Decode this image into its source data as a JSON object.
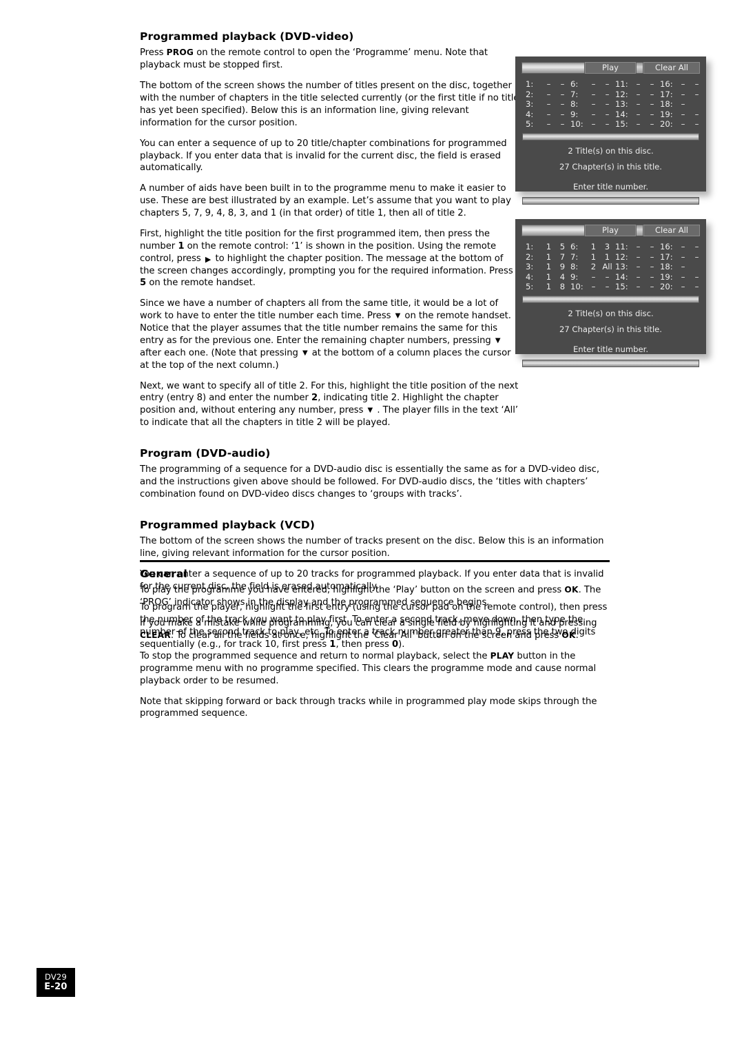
{
  "sections": {
    "dvd_video": {
      "heading": "Programmed playback (DVD-video)",
      "p1_a": "Press ",
      "p1_b": "PROG",
      "p1_c": " on the remote control to open the ‘Programme’ menu. Note that playback must be stopped first.",
      "p2": "The bottom of the screen shows the number of titles present on the disc, together with the number of chapters in the title selected currently (or the first title if no title has yet been specified). Below this is an information line, giving relevant information for the cursor position.",
      "p3": "You can enter a sequence of up to 20 title/chapter combinations for programmed playback. If you enter data that is invalid for the current disc, the field is erased automatically.",
      "p4": "A number of aids have been built in to the programme menu to make it easier to use. These are best illustrated by an example. Let’s assume that you want to play chapters 5, 7, 9, 4, 8, 3, and 1 (in that order) of title 1, then all of title 2.",
      "p5_a": "First, highlight the title position for the first programmed item, then press the number ",
      "p5_b": "1",
      "p5_c": " on the remote control: ‘1’ is shown in the position. Using the remote control, press ",
      "p5_arrow": "▶",
      "p5_d": " to highlight the chapter position. The message at the bottom of the screen changes accordingly, prompting you for the required information. Press ",
      "p5_e": "5",
      "p5_f": " on the remote handset.",
      "p6_a": "Since we have a number of chapters all from the same title, it would be a lot of work to have to enter the title number each time. Press ",
      "p6_arrow1": "▼",
      "p6_b": " on the remote handset. Notice that the player assumes that the title number remains the same for this entry as for the previous one. Enter the remaining chapter numbers, pressing ",
      "p6_arrow2": "▼",
      "p6_c": " after each one. (Note that pressing ",
      "p6_arrow3": "▼",
      "p6_d": " at the bottom of a column places the cursor at the top of the next column.)",
      "p7_a": "Next, we want to specify all of title 2. For this, highlight the title position of the next entry (entry 8) and enter the number ",
      "p7_b": "2",
      "p7_c": ", indicating title 2. Highlight the chapter position and, without entering any number, press ",
      "p7_arrow": "▼",
      "p7_d": " . The player fills in the text ‘All’ to indicate that all the chapters in title 2 will be played."
    },
    "dvd_audio": {
      "heading": "Program (DVD-audio)",
      "p1": "The programming of a sequence for a DVD-audio disc is essentially the same as for a DVD-video disc, and the instructions given above should be followed. For DVD-audio discs, the ‘titles with chapters’ combination found on DVD-video discs changes to ‘groups with tracks’."
    },
    "vcd": {
      "heading": "Programmed playback (VCD)",
      "p1": "The bottom of the screen shows the number of tracks present on the disc. Below this is an information line, giving relevant information for the cursor position.",
      "p2": "You can enter a sequence of up to 20 tracks for programmed playback. If you enter data that is invalid for the current disc, the field is erased automatically.",
      "p3_a": "To program the player, highlight the first entry (using the cursor pad on the remote control), then press the number of the track you want to play first. To enter a second track, move down, then type the number of the second track to play, etc. To enter a track number greater than 9, press the two digits sequentially (e.g., for track 10, first press ",
      "p3_b": "1",
      "p3_c": ", then press ",
      "p3_d": "0",
      "p3_e": ")."
    },
    "general": {
      "heading": "General",
      "p1_a": "To play the programme you have entered, highlight the ‘Play’ button on the screen and press ",
      "p1_b": "OK",
      "p1_c": ". The ‘PROG’ indicator shows in the display and the programmed sequence begins.",
      "p2_a": "If you make a mistake while programming, you can clear a single field by highlighting it and pressing ",
      "p2_b": "CLEAR",
      "p2_c": ". To clear all the fields at once, highlight the ‘Clear All’ button on the screen and press ",
      "p2_d": "OK",
      "p2_e": ".",
      "p3_a": "To stop the programmed sequence and return to normal playback, select the ",
      "p3_b": "PLAY",
      "p3_c": " button in the programme menu with no programme specified. This clears the programme mode and cause normal playback order to be resumed.",
      "p4": "Note that skipping forward or back through tracks while in programmed play mode skips through the programmed sequence."
    }
  },
  "osd_empty": {
    "play_label": "Play",
    "clear_all_label": "Clear All",
    "entries": [
      {
        "index": "1:",
        "v1": "–",
        "v2": "–"
      },
      {
        "index": "2:",
        "v1": "–",
        "v2": "–"
      },
      {
        "index": "3:",
        "v1": "–",
        "v2": "–"
      },
      {
        "index": "4:",
        "v1": "–",
        "v2": "–"
      },
      {
        "index": "5:",
        "v1": "–",
        "v2": "–"
      },
      {
        "index": "6:",
        "v1": "–",
        "v2": "–"
      },
      {
        "index": "7:",
        "v1": "–",
        "v2": "–"
      },
      {
        "index": "8:",
        "v1": "–",
        "v2": "–"
      },
      {
        "index": "9:",
        "v1": "–",
        "v2": "–"
      },
      {
        "index": "10:",
        "v1": "–",
        "v2": "–"
      },
      {
        "index": "11:",
        "v1": "–",
        "v2": "–"
      },
      {
        "index": "12:",
        "v1": "–",
        "v2": "–"
      },
      {
        "index": "13:",
        "v1": "–",
        "v2": "–"
      },
      {
        "index": "14:",
        "v1": "–",
        "v2": "–"
      },
      {
        "index": "15:",
        "v1": "–",
        "v2": "–"
      },
      {
        "index": "16:",
        "v1": "–",
        "v2": "–"
      },
      {
        "index": "17:",
        "v1": "–",
        "v2": "–"
      },
      {
        "index": "18:",
        "v1": "–",
        "v2": ""
      },
      {
        "index": "19:",
        "v1": "–",
        "v2": "–"
      },
      {
        "index": "20:",
        "v1": "–",
        "v2": "–"
      }
    ],
    "info_line_1": "2  Title(s) on this disc.",
    "info_line_2": "27 Chapter(s) in this title.",
    "prompt": "Enter title number."
  },
  "osd_programmed": {
    "play_label": "Play",
    "clear_all_label": "Clear All",
    "entries": [
      {
        "index": "1:",
        "v1": "1",
        "v2": "5"
      },
      {
        "index": "2:",
        "v1": "1",
        "v2": "7"
      },
      {
        "index": "3:",
        "v1": "1",
        "v2": "9"
      },
      {
        "index": "4:",
        "v1": "1",
        "v2": "4"
      },
      {
        "index": "5:",
        "v1": "1",
        "v2": "8"
      },
      {
        "index": "6:",
        "v1": "1",
        "v2": "3"
      },
      {
        "index": "7:",
        "v1": "1",
        "v2": "1"
      },
      {
        "index": "8:",
        "v1": "2",
        "v2": "All"
      },
      {
        "index": "9:",
        "v1": "–",
        "v2": "–"
      },
      {
        "index": "10:",
        "v1": "–",
        "v2": "–"
      },
      {
        "index": "11:",
        "v1": "–",
        "v2": "–"
      },
      {
        "index": "12:",
        "v1": "–",
        "v2": "–"
      },
      {
        "index": "13:",
        "v1": "–",
        "v2": "–"
      },
      {
        "index": "14:",
        "v1": "–",
        "v2": "–"
      },
      {
        "index": "15:",
        "v1": "–",
        "v2": "–"
      },
      {
        "index": "16:",
        "v1": "–",
        "v2": "–"
      },
      {
        "index": "17:",
        "v1": "–",
        "v2": "–"
      },
      {
        "index": "18:",
        "v1": "–",
        "v2": ""
      },
      {
        "index": "19:",
        "v1": "–",
        "v2": "–"
      },
      {
        "index": "20:",
        "v1": "–",
        "v2": "–"
      }
    ],
    "info_line_1": "2  Title(s) on this disc.",
    "info_line_2": "27 Chapter(s) in this title.",
    "prompt": "Enter title number."
  },
  "footer": {
    "model": "DV29",
    "page": "E-20"
  }
}
